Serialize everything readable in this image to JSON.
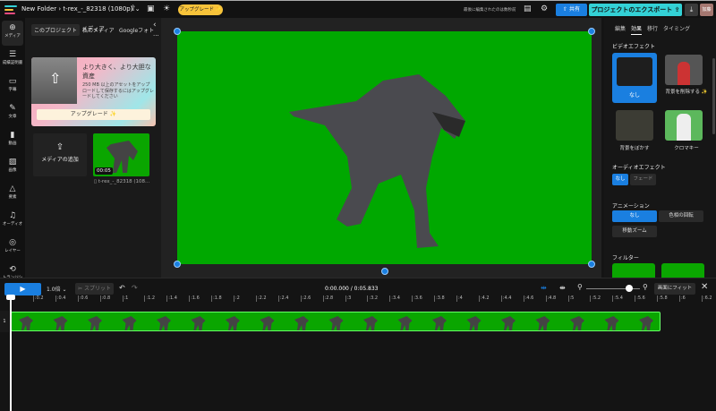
{
  "topbar": {
    "folder": "New Folder",
    "sep": "›",
    "project": "t-rex_-_82318 (1080p)",
    "upgrade": "アップグレード ✨",
    "last_edited": "最後に編集されたのは数秒前",
    "share": "共有",
    "export": "プロジェクトのエクスポート",
    "avatar": "加藤"
  },
  "sidebar": {
    "items": [
      {
        "label": "メディア",
        "icon": "⊕"
      },
      {
        "label": "成績証明書",
        "icon": "☰"
      },
      {
        "label": "字幕",
        "icon": "▭"
      },
      {
        "label": "文章",
        "icon": "✎"
      },
      {
        "label": "動画",
        "icon": "▮"
      },
      {
        "label": "画像",
        "icon": "▨"
      },
      {
        "label": "要素",
        "icon": "△"
      },
      {
        "label": "オーディオ",
        "icon": "♫"
      },
      {
        "label": "レイヤー",
        "icon": "◎"
      },
      {
        "label": "トランジション",
        "icon": "⟲"
      }
    ]
  },
  "media": {
    "title": "メディア",
    "tabs": [
      "このプロジェクト",
      "私のメディア",
      "Googleフォト"
    ],
    "promo_title": "より大きく、より大胆な資産",
    "promo_text": "250 MB 以上のアセットをアップロードして保存するにはアップグレードしてください",
    "promo_button": "アップグレード ✨",
    "add_media": "メディアの追加",
    "clip_duration": "00:05",
    "clip_name": "t-rex_-_82318 (108..."
  },
  "right": {
    "tabs": [
      "編集",
      "効果",
      "移行",
      "タイミング"
    ],
    "active_tab": "効果",
    "video_effects_title": "ビデオエフェクト",
    "video_effects": [
      "なし",
      "背景を削除する ✨",
      "背景をぼかす",
      "クロマキー"
    ],
    "audio_effects_title": "オーディオエフェクト",
    "audio_effects": [
      "なし",
      "フェード"
    ],
    "animation_title": "アニメーション",
    "animations": [
      "なし",
      "色相の回転",
      "移動ズーム"
    ],
    "filter_title": "フィルター"
  },
  "timeline": {
    "speed": "1.0倍 ⌄",
    "split": "✂ スプリット",
    "time": "0:00.000 / 0:05.833",
    "fit": "画面にフィット",
    "track": "1",
    "ticks": [
      "0",
      ":0.2",
      ":0.4",
      ":0.6",
      ":0.8",
      ":1",
      ":1.2",
      ":1.4",
      ":1.6",
      ":1.8",
      ":2",
      ":2.2",
      ":2.4",
      ":2.6",
      ":2.8",
      ":3",
      ":3.2",
      ":3.4",
      ":3.6",
      ":3.8",
      ":4",
      ":4.2",
      ":4.4",
      ":4.6",
      ":4.8",
      ":5",
      ":5.2",
      ":5.4",
      ":5.6",
      ":5.8",
      ":6",
      ":6.2"
    ],
    "zoom_level": 0.8,
    "duration_s": 5.833
  },
  "colors": {
    "accent": "#1a7fe0",
    "export": "#33d1d6",
    "upgrade": "#f7c33a",
    "chroma": "#00a800"
  }
}
